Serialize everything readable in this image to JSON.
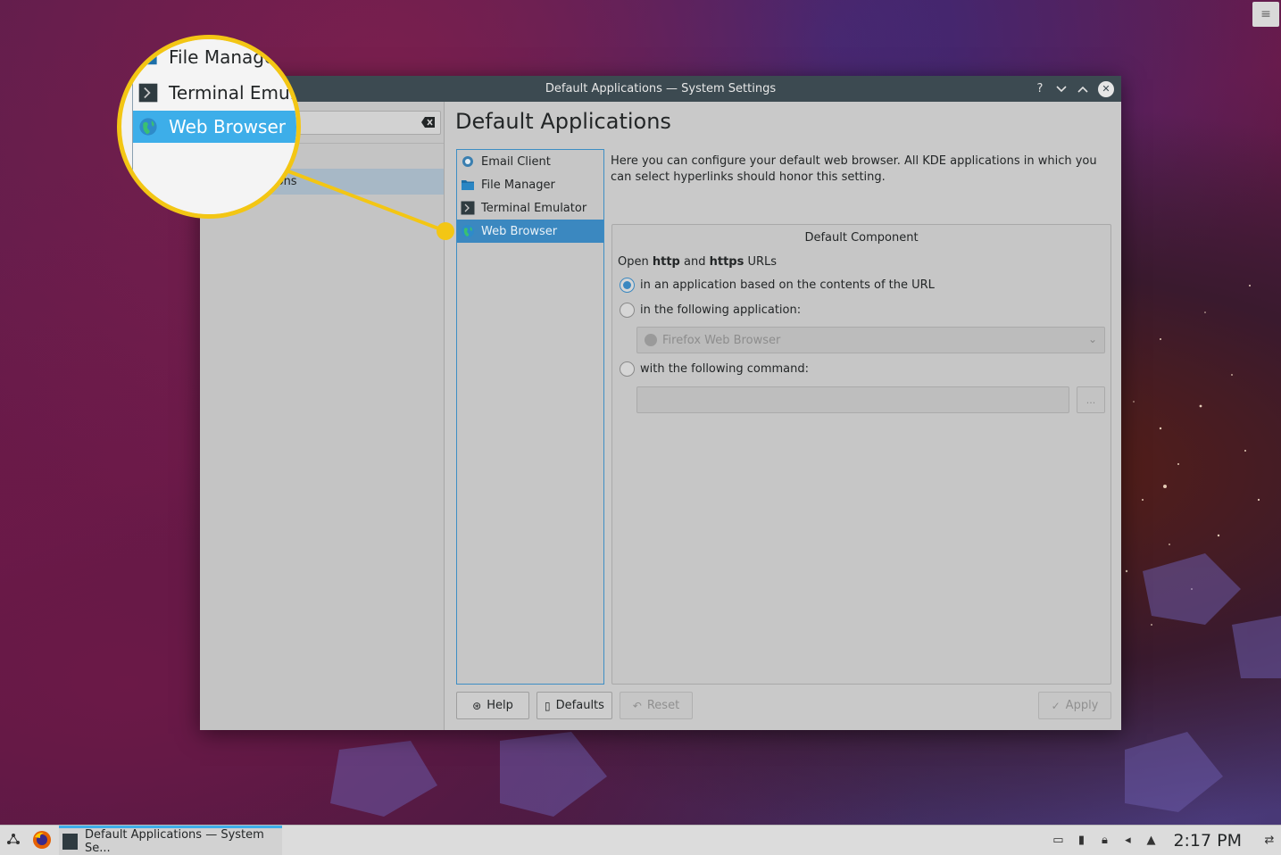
{
  "window": {
    "title": "Default Applications — System Settings",
    "page_title": "Default Applications",
    "sidebar_selected_partial": "ions"
  },
  "categories": [
    {
      "label": "Email Client",
      "icon": "email-client-icon"
    },
    {
      "label": "File Manager",
      "icon": "folder-icon"
    },
    {
      "label": "Terminal Emulator",
      "icon": "terminal-icon"
    },
    {
      "label": "Web Browser",
      "icon": "globe-icon",
      "selected": true
    }
  ],
  "description": "Here you can configure your default web browser. All KDE applications in which you can select hyperlinks should honor this setting.",
  "group": {
    "title": "Default Component",
    "open_prefix": "Open ",
    "open_http": "http",
    "open_and": " and ",
    "open_https": "https",
    "open_suffix": " URLs",
    "option1": "in an application based on the contents of the URL",
    "option2": "in the following application:",
    "app_selected": "Firefox Web Browser",
    "option3": "with the following command:",
    "command_value": "",
    "browse_label": "..."
  },
  "buttons": {
    "help": "Help",
    "defaults": "Defaults",
    "reset": "Reset",
    "apply": "Apply"
  },
  "magnifier": {
    "row1": "File Manage",
    "row2": "Terminal Emula",
    "row3": "Web Browser"
  },
  "taskbar": {
    "task_label": "Default Applications — System Se...",
    "clock": "2:17 PM"
  },
  "colors": {
    "accent": "#3daee9",
    "callout": "#f3c614",
    "titlebar": "#3c4a51"
  }
}
